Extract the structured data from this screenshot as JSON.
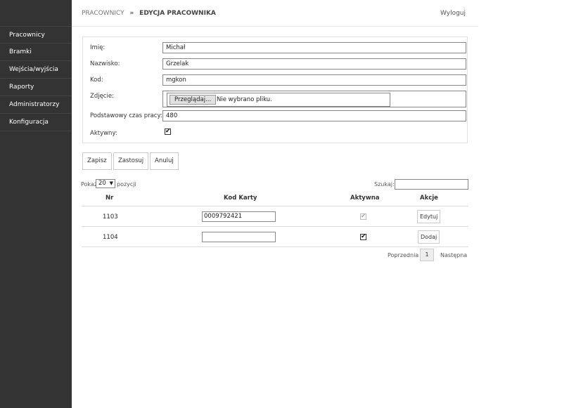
{
  "sidebar": {
    "items": [
      {
        "label": "Pracownicy"
      },
      {
        "label": "Bramki"
      },
      {
        "label": "Wejścia/wyjścia"
      },
      {
        "label": "Raporty"
      },
      {
        "label": "Administratorzy"
      },
      {
        "label": "Konfiguracja"
      }
    ]
  },
  "header": {
    "breadcrumb_parent": "PRACOWNICY",
    "breadcrumb_sep": "»",
    "breadcrumb_current": "EDYCJA PRACOWNIKA",
    "logout": "Wyloguj"
  },
  "form": {
    "first_name_label": "Imię:",
    "first_name_value": "Michał",
    "last_name_label": "Nazwisko:",
    "last_name_value": "Grzelak",
    "code_label": "Kod:",
    "code_value": "mgkon",
    "photo_label": "Zdjęcie:",
    "photo_button": "Przeglądaj...",
    "photo_status": "Nie wybrano pliku.",
    "worktime_label": "Podstawowy czas pracy:",
    "worktime_value": "480",
    "active_label": "Aktywny:",
    "active_checked": true
  },
  "actions": {
    "save": "Zapisz",
    "apply": "Zastosuj",
    "cancel": "Anuluj"
  },
  "table": {
    "show_prefix": "Pokaż",
    "page_size": "20",
    "show_suffix": "pozycji",
    "search_label": "Szukaj:",
    "columns": [
      "Nr",
      "Kod Karty",
      "Aktywna",
      "Akcje"
    ],
    "rows": [
      {
        "nr": "1103",
        "card": "0009792421",
        "active": true,
        "action": "Edytuj"
      },
      {
        "nr": "1104",
        "card": "",
        "active": true,
        "action": "Dodaj"
      }
    ],
    "prev": "Poprzednia",
    "page": "1",
    "next": "Następna"
  }
}
